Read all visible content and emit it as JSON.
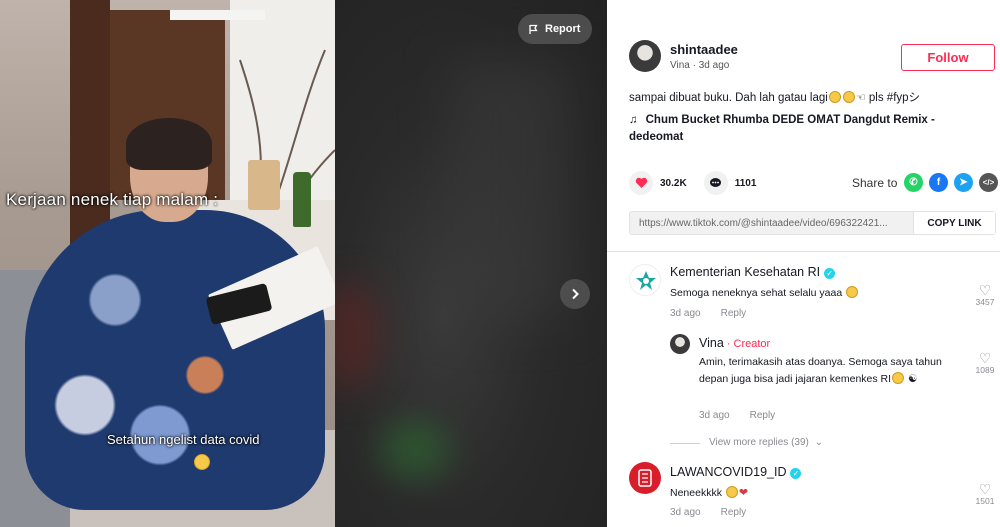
{
  "video": {
    "caption_top": "Kerjaan nenek tiap malam :",
    "caption_bottom": "Setahun ngelist data covid",
    "report_label": "Report",
    "report_icon": "flag-icon",
    "next_icon": "chevron-right-icon"
  },
  "author": {
    "username": "shintaadee",
    "display_name": "Vina",
    "time_ago": "3d ago",
    "follow_label": "Follow"
  },
  "description": {
    "text_start": "sampai dibuat buku. Dah lah gatau lagi",
    "text_end": " pls #fypシ"
  },
  "music": {
    "title": "Chum Bucket Rhumba DEDE OMAT Dangdut Remix - dedeomat"
  },
  "stats": {
    "likes": "30.2K",
    "comments": "1101"
  },
  "share": {
    "label": "Share to",
    "icons": [
      "whatsapp-icon",
      "facebook-icon",
      "twitter-icon",
      "embed-icon"
    ],
    "colors": {
      "whatsapp": "#25d366",
      "facebook": "#1877f2",
      "twitter": "#1da1f2",
      "embed": "#565656"
    }
  },
  "link": {
    "url": "https://www.tiktok.com/@shintaadee/video/696322421...",
    "copy_label": "COPY LINK"
  },
  "comments": [
    {
      "author": "Kementerian Kesehatan RI",
      "verified": true,
      "text": "Semoga neneknya sehat selalu yaaa",
      "time": "3d ago",
      "reply_label": "Reply",
      "likes": "3457",
      "replies": [
        {
          "author": "Vina",
          "badge": "· Creator",
          "text": "Amin, terimakasih atas doanya. Semoga saya tahun depan juga bisa jadi jajaran kemenkes RI",
          "time": "3d ago",
          "reply_label": "Reply",
          "likes": "1089"
        }
      ],
      "view_more": "View more replies (39)"
    },
    {
      "author": "LAWANCOVID19_ID",
      "verified": true,
      "text": "Neneekkkk",
      "time": "3d ago",
      "reply_label": "Reply",
      "likes": "1501"
    }
  ],
  "colors": {
    "accent": "#fe2c55",
    "verified": "#20d5ec",
    "muted": "#8a8b91"
  }
}
